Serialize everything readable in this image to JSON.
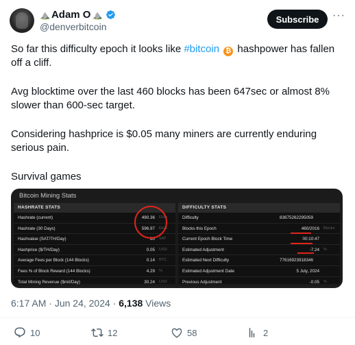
{
  "author": {
    "name": "Adam O",
    "name_emoji": "⛰️",
    "handle": "@denverbitcoin"
  },
  "header": {
    "subscribe_label": "Subscribe",
    "more_label": "···"
  },
  "tweet": {
    "line1_pre": "So far this difficulty epoch it looks like ",
    "hashtag": "#bitcoin",
    "line1_post": " hashpower has fallen off a cliff.",
    "para2": "Avg blocktime over the last 460 blocks has been 647sec or almost 8% slower than 600-sec target.",
    "para3": "Considering hashprice is $0.05 many miners are currently enduring serious pain.",
    "para4": "Survival games"
  },
  "card": {
    "title": "Bitcoin Mining Stats",
    "left": {
      "header": "HASHRATE STATS",
      "rows": [
        {
          "label": "Hashrate (current)",
          "value": "490.36",
          "unit": "EH/s"
        },
        {
          "label": "Hashrate (30 Days)",
          "value": "596.97",
          "unit": "EH/s"
        },
        {
          "label": "Hashvalue (SAT/TH/Day)",
          "value": "80",
          "unit": "SAT"
        },
        {
          "label": "Hashprice ($/TH/Day)",
          "value": "0.05",
          "unit": "USD"
        },
        {
          "label": "Average Fees per Block (144 Blocks)",
          "value": "0.14",
          "unit": "BTC"
        },
        {
          "label": "Fees % of Block Reward (144 Blocks)",
          "value": "4.29",
          "unit": "%"
        },
        {
          "label": "Total Mining Revenue ($mil/Day)",
          "value": "30.24",
          "unit": "USD"
        }
      ]
    },
    "right": {
      "header": "DIFFICULTY STATS",
      "rows": [
        {
          "label": "Difficulty",
          "value": "83675262295059",
          "unit": ""
        },
        {
          "label": "Blocks this Epoch",
          "value": "460/2016",
          "unit": "Blocks"
        },
        {
          "label": "Current Epoch Block Time",
          "value": "00:10:47",
          "unit": ""
        },
        {
          "label": "Estimated Adjustment",
          "value": "-7.24",
          "unit": "%"
        },
        {
          "label": "Estimated Next Difficulty",
          "value": "77616923918346",
          "unit": ""
        },
        {
          "label": "Estimated Adjustment Date",
          "value": "5 July, 2024",
          "unit": ""
        },
        {
          "label": "Previous Adjustment",
          "value": "-0.05",
          "unit": "%"
        }
      ]
    }
  },
  "meta": {
    "time": "6:17 AM",
    "sep": " · ",
    "date": "Jun 24, 2024",
    "views_count": "6,138",
    "views_label": " Views"
  },
  "actions": {
    "replies": "10",
    "reposts": "12",
    "likes": "58",
    "bookmarks": "2"
  },
  "colors": {
    "accent": "#1d9bf0",
    "highlight": "#e0241b",
    "bitcoin": "#f7931a"
  }
}
